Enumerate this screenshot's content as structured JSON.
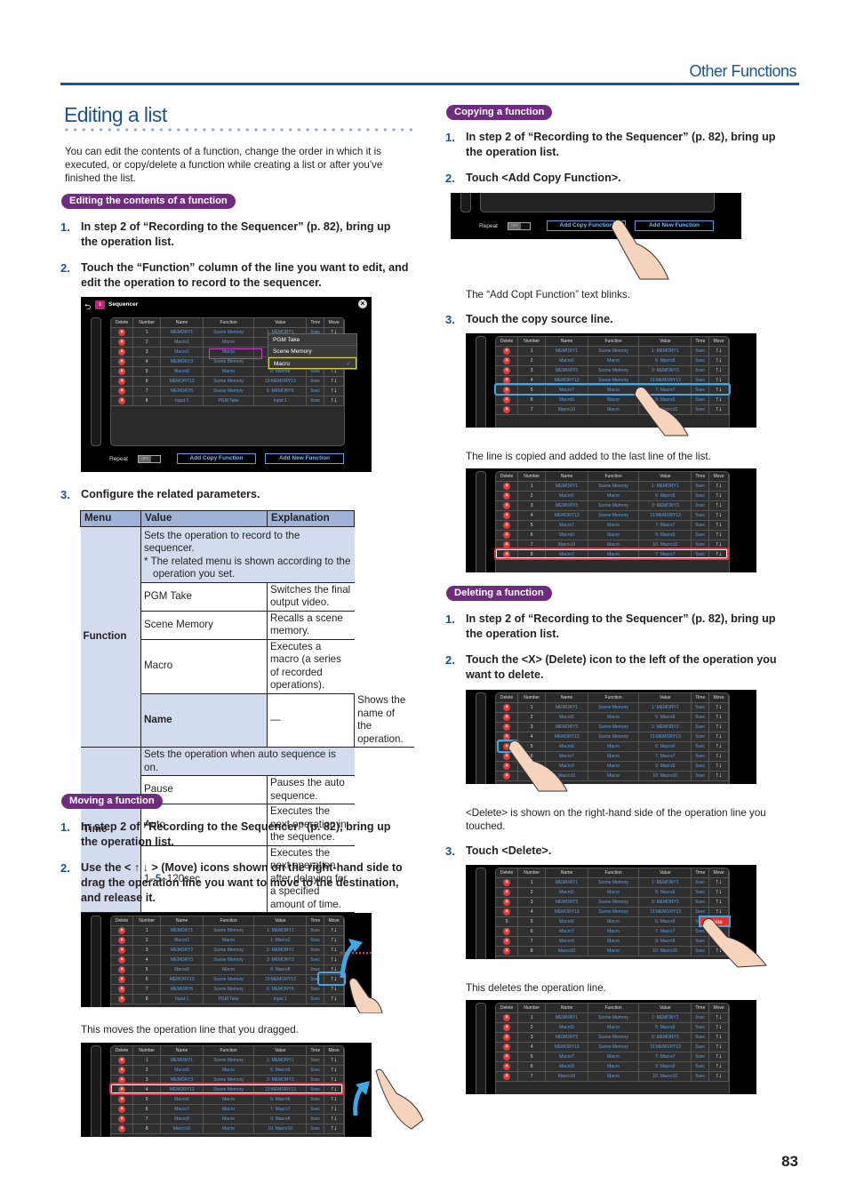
{
  "header": {
    "section_title": "Other Functions",
    "page_number": "83"
  },
  "page_title": "Editing a list",
  "intro": "You can edit the contents of a function, change the order in which it is executed, or copy/delete a function while creating a list or after you've finished the list.",
  "sections": {
    "edit": {
      "pill": "Editing the contents of a function",
      "step1": "In step 2 of “Recording to the Sequencer” (p. 82), bring up the operation list.",
      "step2": "Touch the “Function” column of the line you want to edit, and edit the operation to record to the sequencer.",
      "step3": "Configure the related parameters."
    },
    "move": {
      "pill": "Moving a function",
      "step1": "In step 2 of “Recording to the Sequencer” (p. 82), bring up the operation list.",
      "step2": "Use the < ↑ ↓ > (Move) icons shown on the right-hand side to drag the operation line you want to move to the destination, and release it.",
      "caption": "This moves the operation line that you dragged."
    },
    "copy": {
      "pill": "Copying a function",
      "step1": "In step 2 of “Recording to the Sequencer” (p. 82), bring up the operation list.",
      "step2": "Touch <Add Copy Function>.",
      "caption1": "The “Add Copt Function” text blinks.",
      "step3": "Touch the copy source line.",
      "caption2": "The line is copied and added to the last line of the list."
    },
    "delete": {
      "pill": "Deleting a function",
      "step1": "In step 2 of “Recording to the Sequencer” (p. 82), bring up the operation list.",
      "step2": "Touch the <X> (Delete) icon to the left of the operation you want to delete.",
      "caption1": "<Delete> is shown on the right-hand side of the operation line you touched.",
      "step3": "Touch <Delete>.",
      "caption2": "This deletes the operation line."
    }
  },
  "step_numbers": [
    "1.",
    "2.",
    "3."
  ],
  "param_table": {
    "headers": [
      "Menu",
      "Value",
      "Explanation"
    ],
    "function_menu": "Function",
    "function_note1": "Sets the operation to record to the sequencer.",
    "function_note2": "* The related menu is shown according to the operation you set.",
    "function_rows": [
      {
        "value": "PGM Take",
        "explanation": "Switches the final output video."
      },
      {
        "value": "Scene Memory",
        "explanation": "Recalls a scene memory."
      },
      {
        "value": "Macro",
        "explanation": "Executes a macro (a series of recorded operations)."
      }
    ],
    "name_menu": "Name",
    "name_value": "—",
    "name_explanation": "Shows the name of the operation.",
    "time_menu": "Time",
    "time_note": "Sets the operation when auto sequence is on.",
    "time_rows": [
      {
        "value": "Pause",
        "explanation": "Pauses the auto sequence."
      },
      {
        "value": "Auto",
        "explanation": "Executes the next operation in the sequence."
      }
    ],
    "time_range_pre": "1–",
    "time_range_default": "5",
    "time_range_post": "–120sec",
    "time_range_explanation": "Executes the next operation after delaying for a specified amount of time."
  },
  "ui": {
    "app_title": "Sequencer",
    "columns": [
      "Delete",
      "Number",
      "Name",
      "Function",
      "Value",
      "Time",
      "Move"
    ],
    "repeat_label": "Repeat",
    "repeat_state": "OFF",
    "add_copy": "Add Copy Function",
    "add_new": "Add New Function",
    "delete_button": "Delete",
    "move_glyph": "↑↓",
    "delete_glyph": "×",
    "dropdown": [
      "PGM Take",
      "Scene Memory",
      "Macro"
    ],
    "dropdown_selected": "Macro",
    "check_glyph": "✓"
  },
  "tables": {
    "edit": [
      [
        "1",
        "MEMORY1",
        "Scene Memory",
        "1: MEMORY1",
        "5sec"
      ],
      [
        "2",
        "Macro1",
        "Macro",
        "1: Macro1",
        "5sec"
      ],
      [
        "3",
        "Macro1",
        "Macro",
        "1: Macro1",
        "5sec"
      ],
      [
        "4",
        "MEMORY3",
        "Scene Memory",
        "3: MEMORY3",
        "5sec"
      ],
      [
        "5",
        "Macro8",
        "Macro",
        "8: Macro8",
        "5sec"
      ],
      [
        "6",
        "MEMORY13",
        "Scene Memory",
        "13:MEMORY13",
        "5sec"
      ],
      [
        "7",
        "MEMORY6",
        "Scene Memory",
        "6: MEMORY6",
        "5sec"
      ],
      [
        "8",
        "Input 1",
        "PGM Take",
        "Input 1",
        "5sec"
      ]
    ],
    "move_before": [
      [
        "1",
        "MEMORY1",
        "Scene Memory",
        "1: MEMORY1",
        "5sec"
      ],
      [
        "2",
        "Macro1",
        "Macro",
        "1: Macro1",
        "5sec"
      ],
      [
        "3",
        "MEMORY2",
        "Scene Memory",
        "2: MEMORY2",
        "5sec"
      ],
      [
        "4",
        "MEMORY3",
        "Scene Memory",
        "3: MEMORY3",
        "5sec"
      ],
      [
        "5",
        "Macro8",
        "Macro",
        "8: Macro8",
        "5sec"
      ],
      [
        "6",
        "MEMORY13",
        "Scene Memory",
        "13:MEMORY13",
        "5sec"
      ],
      [
        "7",
        "MEMORY6",
        "Scene Memory",
        "6: MEMORY6",
        "5sec"
      ],
      [
        "8",
        "Input 1",
        "PGM Take",
        "Input 1",
        "5sec"
      ]
    ],
    "move_after": [
      [
        "1",
        "MEMORY1",
        "Scene Memory",
        "1: MEMORY1",
        "5sec"
      ],
      [
        "2",
        "Macro5",
        "Macro",
        "5: Macro5",
        "5sec"
      ],
      [
        "3",
        "MEMORY3",
        "Scene Memory",
        "3: MEMORY3",
        "5sec"
      ],
      [
        "4",
        "MEMORY13",
        "Scene Memory",
        "13:MEMORY13",
        "5sec"
      ],
      [
        "5",
        "Macro6",
        "Macro",
        "6: Macro6",
        "5sec"
      ],
      [
        "6",
        "Macro7",
        "Macro",
        "7: Macro7",
        "5sec"
      ],
      [
        "7",
        "Macro9",
        "Macro",
        "9: Macro9",
        "5sec"
      ],
      [
        "8",
        "Macro10",
        "Macro",
        "10: Macro10",
        "5sec"
      ]
    ],
    "copy_source": [
      [
        "1",
        "MEMORY1",
        "Scene Memory",
        "1: MEMORY1",
        "5sec"
      ],
      [
        "2",
        "Macro5",
        "Macro",
        "5: Macro5",
        "5sec"
      ],
      [
        "3",
        "MEMORY3",
        "Scene Memory",
        "3: MEMORY3",
        "5sec"
      ],
      [
        "4",
        "MEMORY13",
        "Scene Memory",
        "13:MEMORY13",
        "5sec"
      ],
      [
        "5",
        "Macro7",
        "Macro",
        "7: Macro7",
        "5sec"
      ],
      [
        "6",
        "Macro9",
        "Macro",
        "9: Macro9",
        "5sec"
      ],
      [
        "7",
        "Macro10",
        "Macro",
        "10: Macro10",
        "5sec"
      ]
    ],
    "copy_result": [
      [
        "1",
        "MEMORY1",
        "Scene Memory",
        "1: MEMORY1",
        "5sec"
      ],
      [
        "2",
        "Macro5",
        "Macro",
        "5: Macro5",
        "5sec"
      ],
      [
        "3",
        "MEMORY3",
        "Scene Memory",
        "3: MEMORY3",
        "5sec"
      ],
      [
        "4",
        "MEMORY13",
        "Scene Memory",
        "13:MEMORY13",
        "5sec"
      ],
      [
        "5",
        "Macro7",
        "Macro",
        "7: Macro7",
        "5sec"
      ],
      [
        "6",
        "Macro9",
        "Macro",
        "9: Macro9",
        "5sec"
      ],
      [
        "7",
        "Macro10",
        "Macro",
        "10: Macro10",
        "5sec"
      ],
      [
        "8",
        "Macro7",
        "Macro",
        "7: Macro7",
        "5sec"
      ]
    ],
    "delete_touch": [
      [
        "1",
        "MEMORY1",
        "Scene Memory",
        "1: MEMORY1",
        "5sec"
      ],
      [
        "2",
        "Macro5",
        "Macro",
        "5: Macro5",
        "5sec"
      ],
      [
        "3",
        "MEMORY3",
        "Scene Memory",
        "3: MEMORY3",
        "5sec"
      ],
      [
        "4",
        "MEMORY13",
        "Scene Memory",
        "13:MEMORY13",
        "5sec"
      ],
      [
        "5",
        "Macro6",
        "Macro",
        "6: Macro6",
        "5sec"
      ],
      [
        "6",
        "Macro7",
        "Macro",
        "7: Macro7",
        "5sec"
      ],
      [
        "7",
        "Macro9",
        "Macro",
        "9: Macro9",
        "5sec"
      ],
      [
        "8",
        "Macro10",
        "Macro",
        "10: Macro10",
        "5sec"
      ]
    ],
    "delete_confirm": [
      [
        "1",
        "MEMORY1",
        "Scene Memory",
        "1: MEMORY1",
        "5sec"
      ],
      [
        "2",
        "Macro5",
        "Macro",
        "5: Macro5",
        "5sec"
      ],
      [
        "3",
        "MEMORY3",
        "Scene Memory",
        "3: MEMORY3",
        "5sec"
      ],
      [
        "4",
        "MEMORY13",
        "Scene Memory",
        "13:MEMORY13",
        "5sec"
      ],
      [
        "5",
        "Macro6",
        "Macro",
        "6: Macro6",
        "5sec"
      ],
      [
        "6",
        "Macro7",
        "Macro",
        "7: Macro7",
        "5sec"
      ],
      [
        "7",
        "Macro9",
        "Macro",
        "9: Macro9",
        "5sec"
      ],
      [
        "8",
        "Macro10",
        "Macro",
        "10: Macro10",
        "5sec"
      ]
    ],
    "delete_result": [
      [
        "1",
        "MEMORY1",
        "Scene Memory",
        "1: MEMORY1",
        "5sec"
      ],
      [
        "2",
        "Macro5",
        "Macro",
        "5: Macro5",
        "5sec"
      ],
      [
        "3",
        "MEMORY3",
        "Scene Memory",
        "3: MEMORY3",
        "5sec"
      ],
      [
        "4",
        "MEMORY13",
        "Scene Memory",
        "13:MEMORY13",
        "5sec"
      ],
      [
        "5",
        "Macro7",
        "Macro",
        "7: Macro7",
        "5sec"
      ],
      [
        "6",
        "Macro9",
        "Macro",
        "9: Macro9",
        "5sec"
      ],
      [
        "7",
        "Macro10",
        "Macro",
        "10: Macro10",
        "5sec"
      ]
    ]
  },
  "colors": {
    "accent": "#1d5393",
    "pill": "#6f2c7f",
    "table_header": "#9fb3d9",
    "table_shade": "#d3dcef",
    "delete_red": "#e03a3a",
    "highlight_blue": "#3fa9e8",
    "highlight_red": "#e8374a"
  }
}
